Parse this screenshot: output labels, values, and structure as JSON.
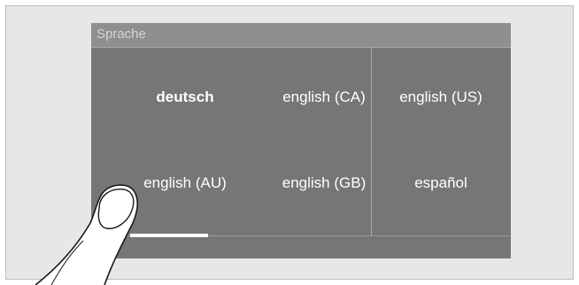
{
  "header": {
    "title": "Sprache"
  },
  "languages": [
    {
      "label": "deutsch",
      "selected": true
    },
    {
      "label": "english (CA)",
      "selected": false
    },
    {
      "label": "english (US)",
      "selected": false
    },
    {
      "label": "english (AU)",
      "selected": false
    },
    {
      "label": "english (GB)",
      "selected": false
    },
    {
      "label": "español",
      "selected": false
    }
  ],
  "scroll_indicator": {
    "page": 1,
    "pages": 2
  },
  "colors": {
    "screen": "#767676",
    "header": "#8f8f8f",
    "text": "#ffffff"
  }
}
